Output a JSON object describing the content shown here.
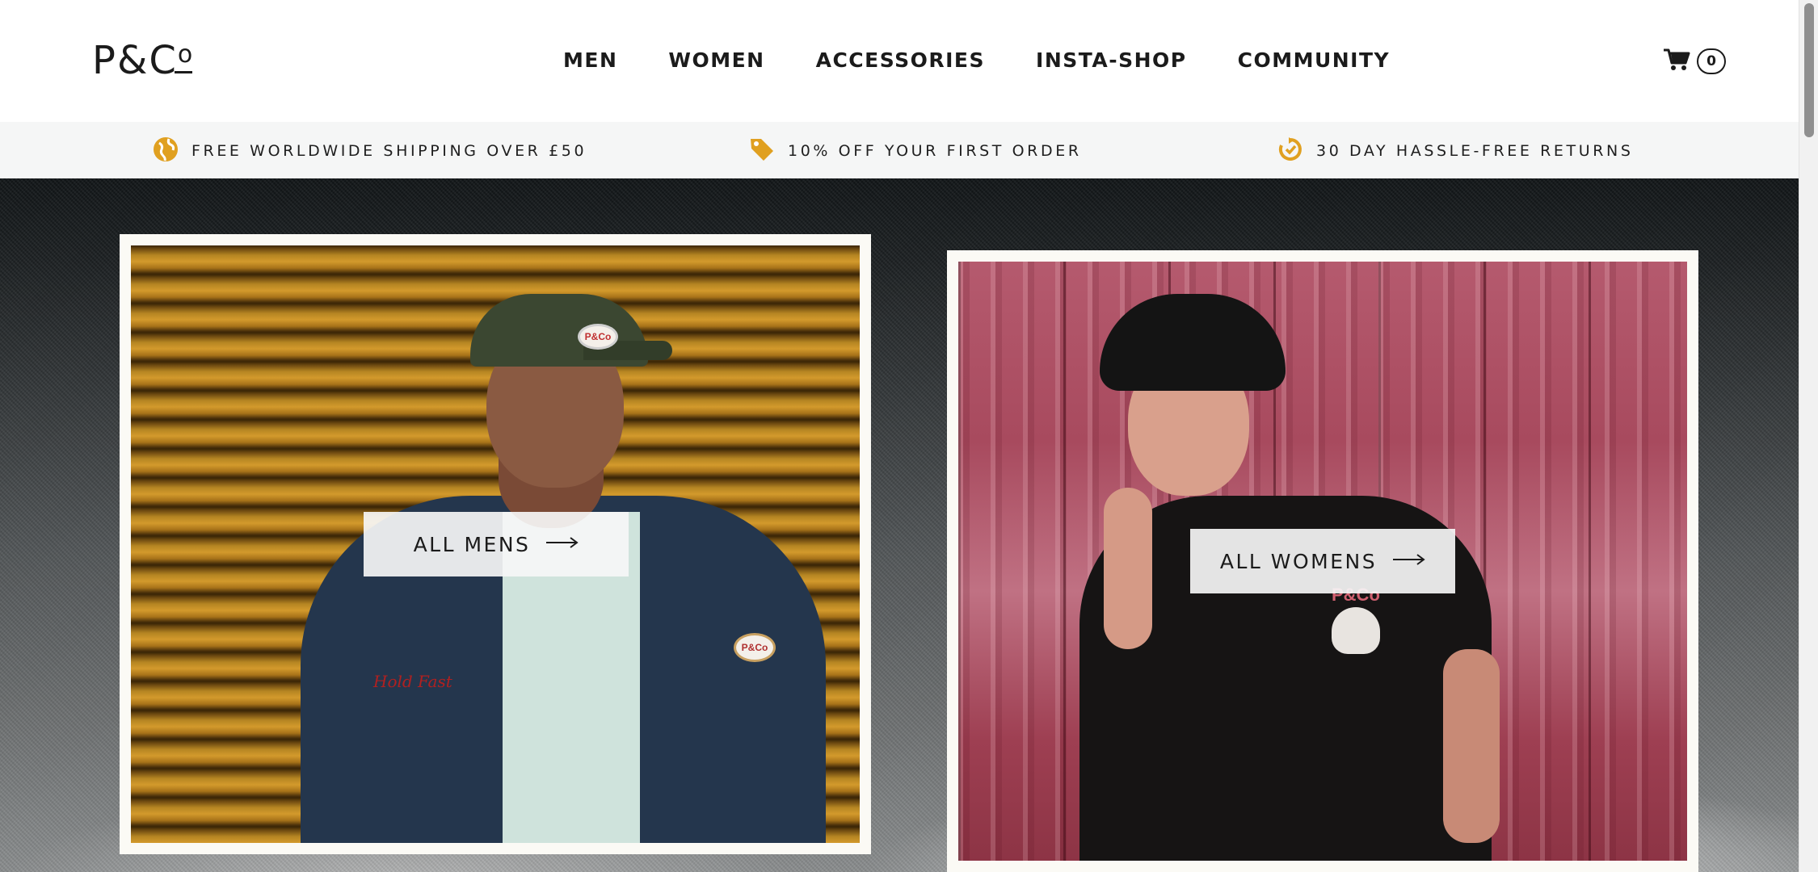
{
  "brand": {
    "logo_text": "P&C",
    "logo_o": "o"
  },
  "nav": {
    "items": [
      {
        "label": "MEN"
      },
      {
        "label": "WOMEN"
      },
      {
        "label": "ACCESSORIES"
      },
      {
        "label": "INSTA-SHOP"
      },
      {
        "label": "COMMUNITY"
      }
    ]
  },
  "cart": {
    "icon": "cart-icon",
    "count": "0"
  },
  "perks": [
    {
      "icon": "globe-icon",
      "text": "FREE WORLDWIDE SHIPPING OVER £50"
    },
    {
      "icon": "tag-icon",
      "text": "10% OFF YOUR FIRST ORDER"
    },
    {
      "icon": "return-icon",
      "text": "30 DAY HASSLE-FREE RETURNS"
    }
  ],
  "hero": {
    "men": {
      "cta_label": "ALL MENS",
      "cap_badge": "P&Co",
      "jacket_badge": "P&Co",
      "jacket_script": "Hold Fast"
    },
    "women": {
      "cta_label": "ALL WOMENS",
      "shirt_print": "P&Co"
    }
  },
  "colors": {
    "accent": "#e0a020",
    "text": "#1b1b1b",
    "perks_bg": "#f5f6f6"
  }
}
